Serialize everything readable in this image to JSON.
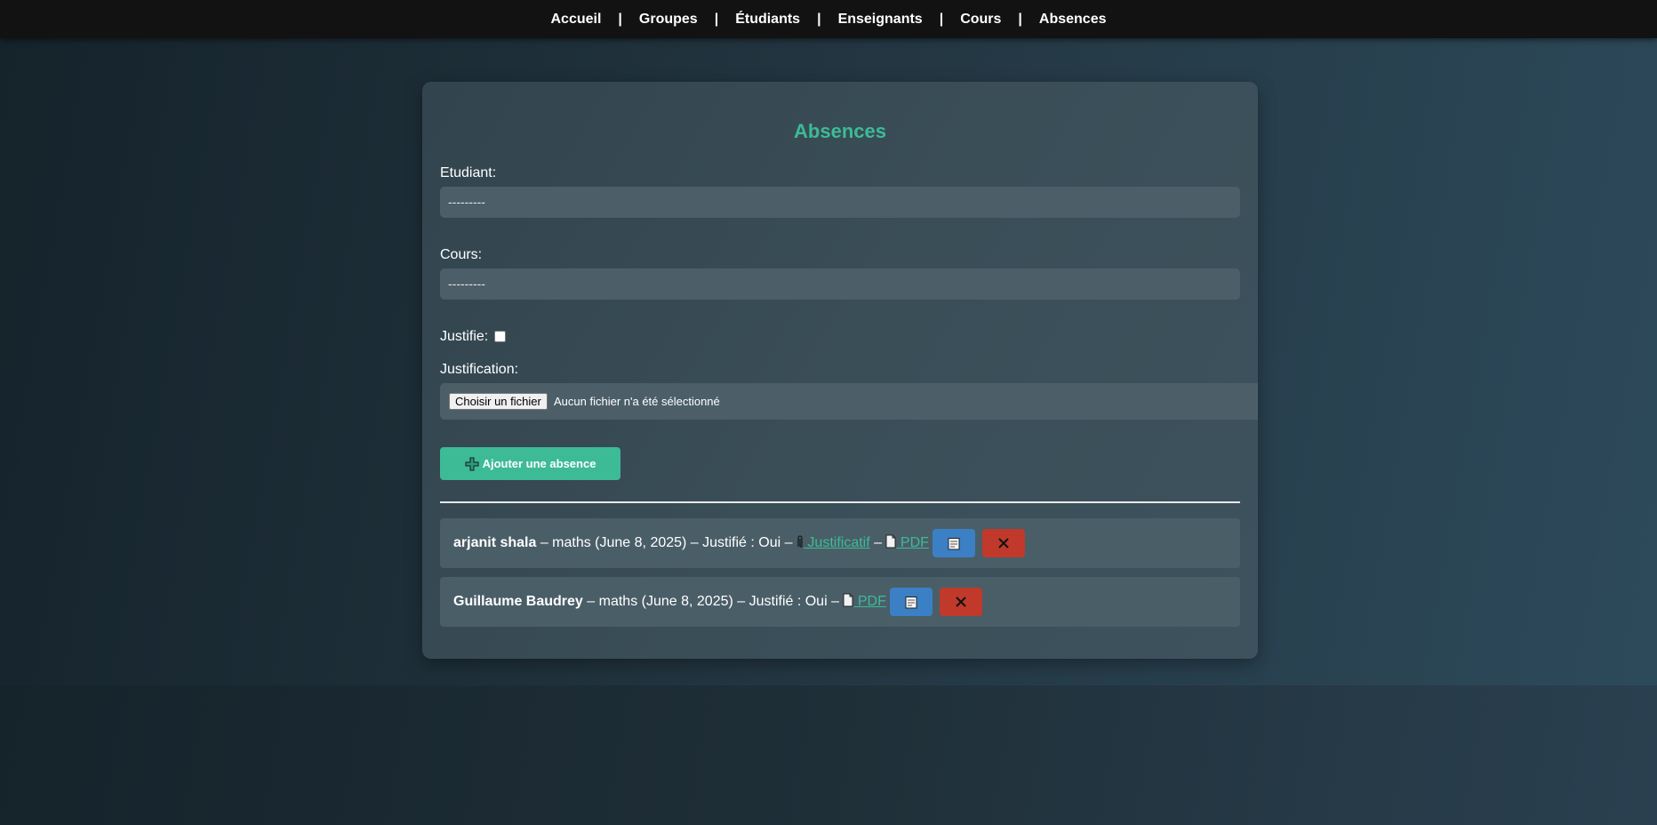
{
  "nav": {
    "items": [
      "Accueil",
      "Groupes",
      "Étudiants",
      "Enseignants",
      "Cours",
      "Absences"
    ],
    "separator": "|"
  },
  "form": {
    "title": "Absences",
    "etudiant_label": "Etudiant:",
    "etudiant_value": "---------",
    "cours_label": "Cours:",
    "cours_value": "---------",
    "justifie_label": "Justifie:",
    "justifie_checked": false,
    "justification_label": "Justification:",
    "file_button": "Choisir un fichier",
    "file_status": "Aucun fichier n'a été sélectionné",
    "submit_label": "Ajouter une absence"
  },
  "absences": [
    {
      "student": "arjanit shala",
      "details": " – maths (June 8, 2025) – Justifié : Oui – ",
      "justificatif_link": " Justificatif",
      "sep": " – ",
      "pdf_link": " PDF"
    },
    {
      "student": "Guillaume Baudrey",
      "details": " – maths (June 8, 2025) – Justifié : Oui – ",
      "pdf_link": " PDF"
    }
  ],
  "icons": {
    "add": "plus-icon",
    "justificatif": "paperclip-icon",
    "pdf": "document-icon",
    "edit": "memo-icon",
    "delete": "close-icon"
  },
  "colors": {
    "accent": "#3dbb96",
    "edit": "#3b80c4",
    "delete": "#c0392b",
    "navbar": "#121212"
  }
}
